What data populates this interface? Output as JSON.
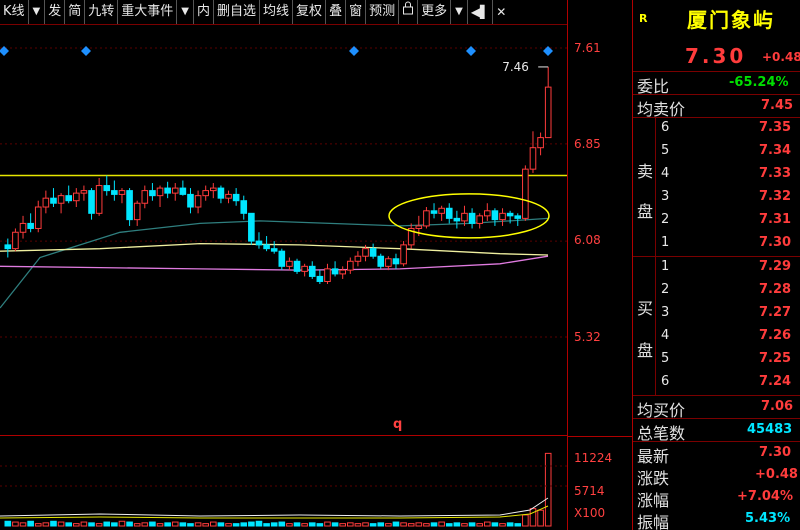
{
  "toolbar": {
    "items": [
      "K线",
      "发",
      "简",
      "九转",
      "重大事件",
      "内",
      "删自选",
      "均线",
      "复权",
      "叠",
      "窗",
      "预测",
      "更多"
    ],
    "lock_icon": "lock-icon",
    "pin_icon": "pin-icon",
    "close_icon": "close-icon"
  },
  "axis": {
    "price_labels": [
      "7.61",
      "6.85",
      "6.08",
      "5.32"
    ],
    "volume_labels": [
      "11224",
      "5714",
      "X100"
    ]
  },
  "chart_data": {
    "type": "candlestick",
    "price_range": [
      4.8,
      7.75
    ],
    "y_ticks": [
      7.61,
      6.85,
      6.08,
      5.32
    ],
    "support_line": 6.6,
    "high_marker_label": "7.46",
    "marker_q": "q",
    "candles": [
      [
        6.05,
        6.1,
        5.95,
        6.02
      ],
      [
        6.02,
        6.18,
        6.0,
        6.15
      ],
      [
        6.15,
        6.28,
        6.1,
        6.22
      ],
      [
        6.22,
        6.3,
        6.15,
        6.18
      ],
      [
        6.18,
        6.4,
        6.15,
        6.35
      ],
      [
        6.35,
        6.48,
        6.3,
        6.42
      ],
      [
        6.42,
        6.5,
        6.35,
        6.38
      ],
      [
        6.38,
        6.46,
        6.3,
        6.44
      ],
      [
        6.44,
        6.52,
        6.38,
        6.4
      ],
      [
        6.4,
        6.5,
        6.35,
        6.46
      ],
      [
        6.46,
        6.52,
        6.4,
        6.48
      ],
      [
        6.48,
        6.5,
        6.25,
        6.3
      ],
      [
        6.3,
        6.58,
        6.28,
        6.52
      ],
      [
        6.52,
        6.6,
        6.44,
        6.48
      ],
      [
        6.48,
        6.56,
        6.4,
        6.45
      ],
      [
        6.45,
        6.5,
        6.38,
        6.48
      ],
      [
        6.48,
        6.5,
        6.2,
        6.25
      ],
      [
        6.25,
        6.4,
        6.2,
        6.38
      ],
      [
        6.38,
        6.52,
        6.34,
        6.48
      ],
      [
        6.48,
        6.54,
        6.4,
        6.44
      ],
      [
        6.44,
        6.52,
        6.35,
        6.5
      ],
      [
        6.5,
        6.55,
        6.42,
        6.46
      ],
      [
        6.46,
        6.54,
        6.4,
        6.5
      ],
      [
        6.5,
        6.56,
        6.44,
        6.45
      ],
      [
        6.45,
        6.5,
        6.3,
        6.35
      ],
      [
        6.35,
        6.48,
        6.3,
        6.44
      ],
      [
        6.44,
        6.52,
        6.4,
        6.48
      ],
      [
        6.48,
        6.54,
        6.42,
        6.5
      ],
      [
        6.5,
        6.52,
        6.38,
        6.42
      ],
      [
        6.42,
        6.48,
        6.38,
        6.45
      ],
      [
        6.45,
        6.5,
        6.36,
        6.4
      ],
      [
        6.4,
        6.44,
        6.25,
        6.3
      ],
      [
        6.3,
        6.2,
        6.05,
        6.08
      ],
      [
        6.08,
        6.15,
        6.02,
        6.05
      ],
      [
        6.05,
        6.12,
        6.0,
        6.02
      ],
      [
        6.02,
        6.08,
        5.98,
        6.0
      ],
      [
        6.0,
        6.02,
        5.85,
        5.88
      ],
      [
        5.88,
        5.95,
        5.85,
        5.92
      ],
      [
        5.92,
        5.94,
        5.82,
        5.84
      ],
      [
        5.84,
        5.9,
        5.8,
        5.88
      ],
      [
        5.88,
        5.92,
        5.78,
        5.8
      ],
      [
        5.8,
        5.85,
        5.74,
        5.76
      ],
      [
        5.76,
        5.9,
        5.74,
        5.86
      ],
      [
        5.86,
        5.92,
        5.8,
        5.82
      ],
      [
        5.82,
        5.88,
        5.78,
        5.85
      ],
      [
        5.85,
        5.95,
        5.82,
        5.92
      ],
      [
        5.92,
        6.0,
        5.88,
        5.96
      ],
      [
        5.96,
        6.05,
        5.92,
        6.02
      ],
      [
        6.02,
        6.06,
        5.94,
        5.96
      ],
      [
        5.96,
        5.98,
        5.86,
        5.88
      ],
      [
        5.88,
        5.96,
        5.85,
        5.94
      ],
      [
        5.94,
        5.98,
        5.86,
        5.9
      ],
      [
        5.9,
        6.08,
        5.88,
        6.05
      ],
      [
        6.05,
        6.22,
        6.02,
        6.18
      ],
      [
        6.18,
        6.28,
        6.12,
        6.2
      ],
      [
        6.2,
        6.35,
        6.18,
        6.32
      ],
      [
        6.32,
        6.38,
        6.26,
        6.3
      ],
      [
        6.3,
        6.36,
        6.24,
        6.34
      ],
      [
        6.34,
        6.38,
        6.22,
        6.26
      ],
      [
        6.26,
        6.32,
        6.18,
        6.24
      ],
      [
        6.24,
        6.36,
        6.2,
        6.3
      ],
      [
        6.3,
        6.34,
        6.18,
        6.22
      ],
      [
        6.22,
        6.3,
        6.18,
        6.28
      ],
      [
        6.28,
        6.38,
        6.24,
        6.32
      ],
      [
        6.32,
        6.34,
        6.2,
        6.25
      ],
      [
        6.25,
        6.34,
        6.2,
        6.3
      ],
      [
        6.3,
        6.32,
        6.22,
        6.28
      ],
      [
        6.28,
        6.3,
        6.2,
        6.26
      ],
      [
        6.26,
        6.68,
        6.24,
        6.65
      ],
      [
        6.65,
        6.95,
        6.62,
        6.82
      ],
      [
        6.82,
        6.94,
        6.76,
        6.9
      ],
      [
        6.9,
        7.46,
        6.9,
        7.3
      ]
    ],
    "ma_slow": [
      [
        0,
        5.55
      ],
      [
        40,
        5.95
      ],
      [
        120,
        6.15
      ],
      [
        200,
        6.22
      ],
      [
        260,
        6.24
      ],
      [
        330,
        6.22
      ],
      [
        400,
        6.2
      ],
      [
        470,
        6.22
      ],
      [
        548,
        6.26
      ]
    ],
    "ma_yellow": [
      [
        0,
        6.0
      ],
      [
        100,
        6.02
      ],
      [
        200,
        6.06
      ],
      [
        300,
        6.05
      ],
      [
        400,
        6.02
      ],
      [
        500,
        5.98
      ],
      [
        548,
        5.97
      ]
    ],
    "ma_magenta": [
      [
        0,
        5.88
      ],
      [
        100,
        5.87
      ],
      [
        200,
        5.86
      ],
      [
        300,
        5.85
      ],
      [
        400,
        5.86
      ],
      [
        500,
        5.9
      ],
      [
        548,
        5.96
      ]
    ],
    "volumes": [
      6,
      5,
      4,
      6,
      3,
      4,
      6,
      5,
      4,
      3,
      5,
      4,
      3,
      5,
      4,
      6,
      5,
      3,
      4,
      5,
      3,
      4,
      5,
      4,
      3,
      4,
      3,
      5,
      4,
      3,
      3,
      4,
      5,
      6,
      3,
      4,
      5,
      3,
      4,
      3,
      4,
      3,
      5,
      4,
      3,
      4,
      3,
      4,
      3,
      4,
      3,
      5,
      4,
      3,
      4,
      3,
      4,
      5,
      3,
      4,
      3,
      4,
      3,
      5,
      4,
      3,
      4,
      3,
      14,
      22,
      20,
      92
    ],
    "volume_max": 11224
  },
  "panel": {
    "badge": "R",
    "stock_name": "厦门象屿",
    "price": "7.30",
    "change": "+0.48",
    "weibi_label": "委比",
    "weibi_value": "-65.24%",
    "avg_sell_label": "均卖价",
    "avg_sell_value": "7.45",
    "sell_label_1": "卖",
    "sell_label_2": "盘",
    "sell_levels": [
      {
        "n": "6",
        "p": "7.35"
      },
      {
        "n": "5",
        "p": "7.34"
      },
      {
        "n": "4",
        "p": "7.33"
      },
      {
        "n": "3",
        "p": "7.32"
      },
      {
        "n": "2",
        "p": "7.31"
      },
      {
        "n": "1",
        "p": "7.30"
      }
    ],
    "buy_label_1": "买",
    "buy_label_2": "盘",
    "buy_levels": [
      {
        "n": "1",
        "p": "7.29"
      },
      {
        "n": "2",
        "p": "7.28"
      },
      {
        "n": "3",
        "p": "7.27"
      },
      {
        "n": "4",
        "p": "7.26"
      },
      {
        "n": "5",
        "p": "7.25"
      },
      {
        "n": "6",
        "p": "7.24"
      }
    ],
    "avg_buy_label": "均买价",
    "avg_buy_value": "7.06",
    "total_trades_label": "总笔数",
    "total_trades_value": "45483",
    "latest_label": "最新",
    "latest_value": "7.30",
    "zhangdie_label": "涨跌",
    "zhangdie_value": "+0.48",
    "zhangfu_label": "涨幅",
    "zhangfu_value": "+7.04%",
    "zhenfu_label": "振幅",
    "zhenfu_value": "5.43%",
    "colors": {
      "up": "#ff3c3c",
      "down": "#00e000",
      "cyan": "#00e6ff",
      "border": "#b00000"
    }
  }
}
